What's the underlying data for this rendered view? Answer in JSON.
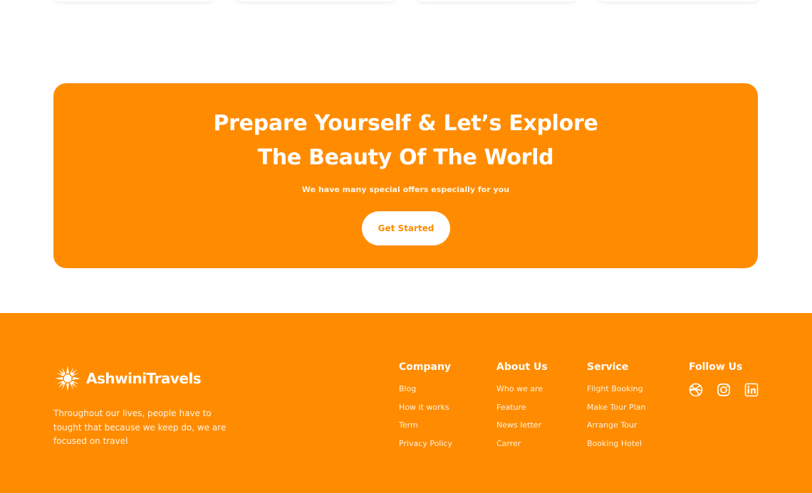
{
  "cta": {
    "title": "Prepare Yourself & Let’s Explore The Beauty Of The World",
    "subtitle": "We have many special offers especially for you",
    "button_label": "Get Started"
  },
  "footer": {
    "brand_name": "AshwiniTravels",
    "brand_icon": "sun-logo-icon",
    "description": "Throughout our lives, people have to tought that because we keep do, we are focused on travel",
    "columns": {
      "company": {
        "title": "Company",
        "links": [
          "Blog",
          "How it works",
          "Term",
          "Privacy Policy"
        ]
      },
      "about": {
        "title": "About Us",
        "links": [
          "Who we are",
          "Feature",
          "News letter",
          "Carrer"
        ]
      },
      "service": {
        "title": "Service",
        "links": [
          "Flight Booking",
          "Make Tour Plan",
          "Arrange Tour",
          "Booking Hotel"
        ]
      },
      "follow": {
        "title": "Follow Us",
        "icons": [
          "dribbble-icon",
          "instagram-icon",
          "linkedin-icon"
        ]
      }
    }
  },
  "colors": {
    "accent": "#ff8c00",
    "background": "#ffffff",
    "text_on_accent": "#ffffff"
  }
}
